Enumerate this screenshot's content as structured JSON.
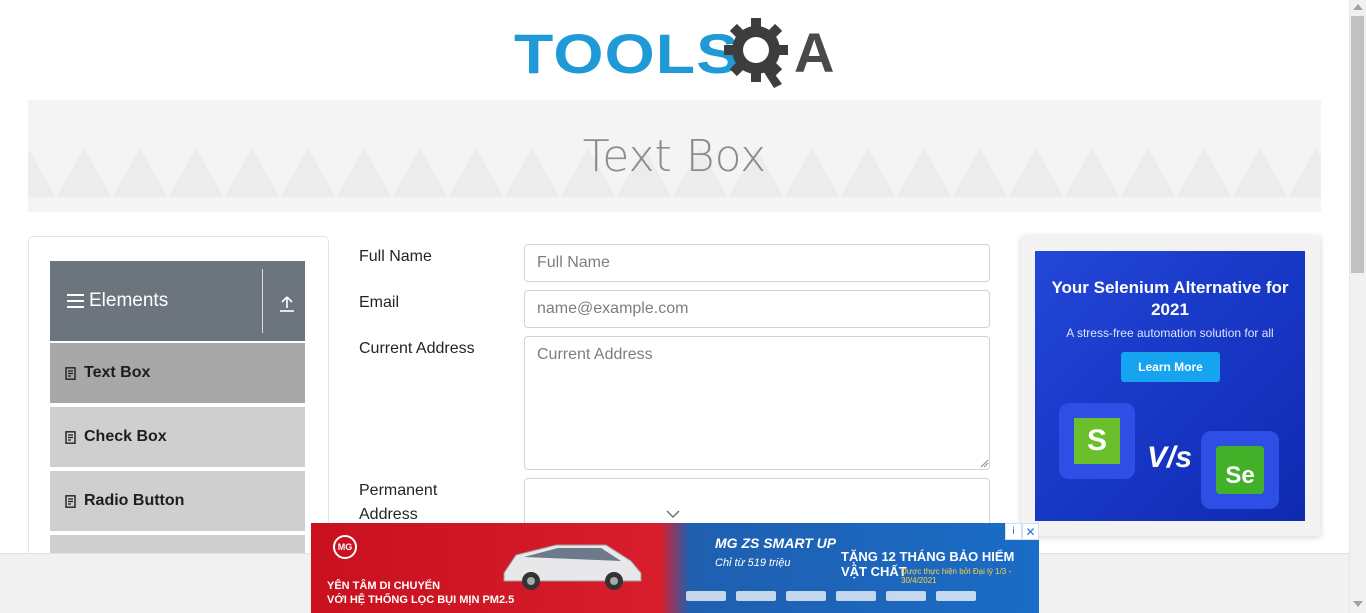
{
  "header": {
    "logo_text_blue": "TOOLS",
    "logo_text_dark": "A",
    "logo_icon": "gear-q-icon"
  },
  "banner": {
    "title": "Text Box"
  },
  "sidebar": {
    "group_label": "Elements",
    "group_icon": "hamburger-icon",
    "collapse_icon": "upload-arrow-icon",
    "items": [
      {
        "label": "Text Box",
        "icon": "document-icon",
        "active": true
      },
      {
        "label": "Check Box",
        "icon": "document-icon",
        "active": false
      },
      {
        "label": "Radio Button",
        "icon": "document-icon",
        "active": false
      }
    ]
  },
  "form": {
    "full_name": {
      "label": "Full Name",
      "placeholder": "Full Name",
      "value": ""
    },
    "email": {
      "label": "Email",
      "placeholder": "name@example.com",
      "value": ""
    },
    "current_address": {
      "label": "Current Address",
      "placeholder": "Current Address",
      "value": ""
    },
    "permanent_address": {
      "label": "Permanent Address",
      "placeholder": "",
      "value": ""
    }
  },
  "side_ad": {
    "headline": "Your Selenium Alternative for 2021",
    "subtext": "A stress-free automation solution for all",
    "cta": "Learn More",
    "logo_left": "S",
    "versus": "V/s",
    "logo_right": "Se"
  },
  "bottom_ad": {
    "brand": "MG",
    "tagline": "YÊN TÂM DI CHUYỂN\nVỚI HỆ THỐNG LỌC BỤI MỊN PM2.5",
    "model": "MG ZS SMART UP",
    "price": "Chỉ từ 519 triệu",
    "offer": "TẶNG 12 THÁNG BẢO HIỂM VẬT CHẤT",
    "offer_note": "Được thực hiện bởi Đại lý 1/3 - 30/4/2021",
    "info_icon": "info-icon",
    "close_icon": "close-icon"
  },
  "colors": {
    "logo_blue": "#1f9ad6",
    "logo_dark": "#4a4a4a",
    "sidebar_header": "#6c757d",
    "menu_active": "#a8a8a8",
    "menu_item": "#cfcfcf",
    "ad_blue": "#1736c4",
    "cta_blue": "#16a3f0"
  }
}
